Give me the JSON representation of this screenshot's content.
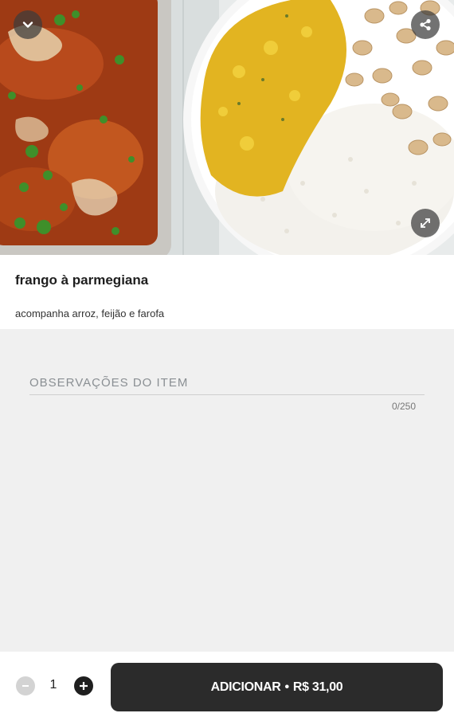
{
  "item": {
    "name": "frango à parmegiana",
    "description": "acompanha arroz, feijão e farofa"
  },
  "notes": {
    "placeholder": "OBSERVAÇÕES DO ITEM",
    "counter": "0/250"
  },
  "cart": {
    "quantity": "1",
    "add_label": "ADICIONAR",
    "separator": "•",
    "price": "R$ 31,00"
  },
  "icons": {
    "back": "chevron-down-icon",
    "share": "share-icon",
    "expand": "expand-icon",
    "minus": "minus-icon",
    "plus": "plus-icon"
  },
  "colors": {
    "button_dark": "#2b2b2b",
    "background": "#f0f0f0"
  }
}
